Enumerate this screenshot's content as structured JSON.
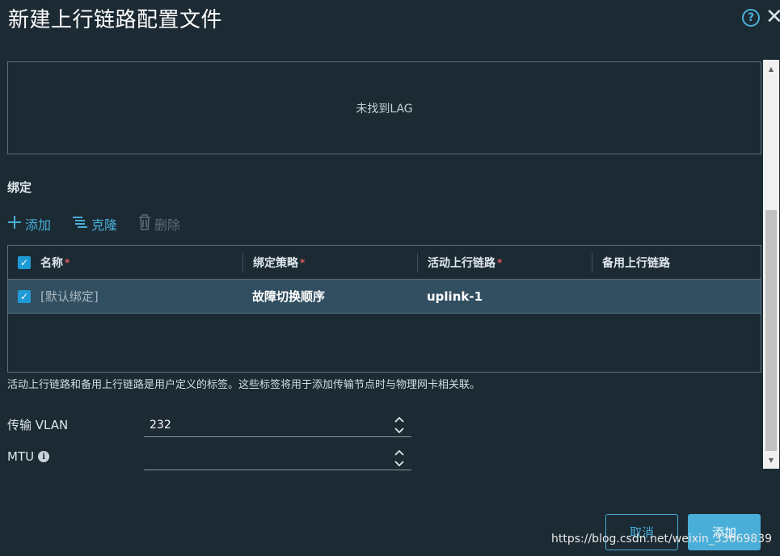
{
  "dialog": {
    "title": "新建上行链路配置文件"
  },
  "lag": {
    "empty_text": "未找到LAG"
  },
  "teaming": {
    "heading": "绑定",
    "toolbar": {
      "add_label": "添加",
      "clone_label": "克隆",
      "delete_label": "删除"
    },
    "columns": {
      "name": "名称",
      "policy": "绑定策略",
      "active": "活动上行链路",
      "standby": "备用上行链路"
    },
    "rows": [
      {
        "name": "[默认绑定]",
        "policy": "故障切换顺序",
        "active": "uplink-1",
        "standby": ""
      }
    ],
    "note": "活动上行链路和备用上行链路是用户定义的标签。这些标签将用于添加传输节点时与物理网卡相关联。"
  },
  "form": {
    "vlan_label": "传输 VLAN",
    "vlan_value": "232",
    "mtu_label": "MTU",
    "mtu_value": ""
  },
  "buttons": {
    "cancel": "取消",
    "add": "添加"
  },
  "watermark": "https://blog.csdn.net/weixin_33669839",
  "icons": {
    "help": "help-circle-icon",
    "close": "close-icon",
    "info": "info-circle-icon",
    "add": "plus-icon",
    "clone": "clone-icon",
    "delete": "trash-icon"
  },
  "colors": {
    "background": "#1c2a33",
    "accent": "#49afd9",
    "selected_row": "#324f61",
    "required": "#e25d5d"
  }
}
